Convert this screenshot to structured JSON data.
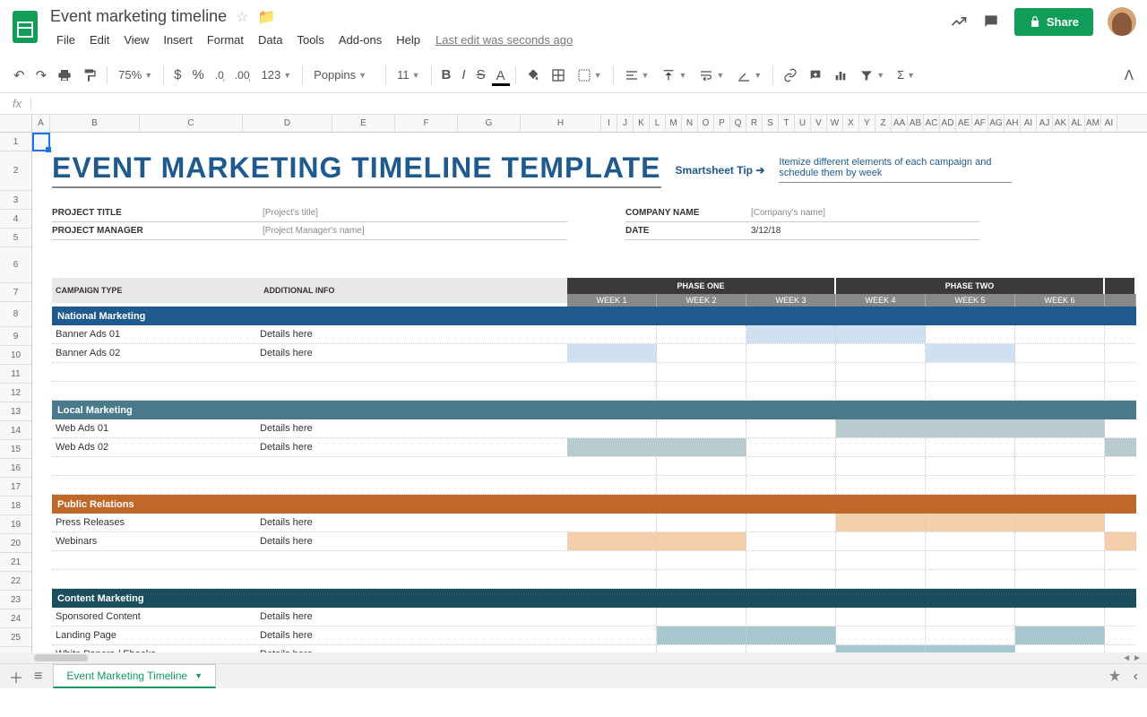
{
  "doc": {
    "title": "Event marketing timeline",
    "last_edit": "Last edit was seconds ago"
  },
  "menu": [
    "File",
    "Edit",
    "View",
    "Insert",
    "Format",
    "Data",
    "Tools",
    "Add-ons",
    "Help"
  ],
  "share": "Share",
  "toolbar": {
    "zoom": "75%",
    "numfmt": "123",
    "font": "Poppins",
    "size": "11"
  },
  "cols_wide": [
    "A",
    "B",
    "C",
    "D",
    "E",
    "F",
    "G",
    "H"
  ],
  "cols_narrow": [
    "I",
    "J",
    "K",
    "L",
    "M",
    "N",
    "O",
    "P",
    "Q",
    "R",
    "S",
    "T",
    "U",
    "V",
    "W",
    "X",
    "Y",
    "Z",
    "AA",
    "AB",
    "AC",
    "AD",
    "AE",
    "AF",
    "AG",
    "AH",
    "AI",
    "AJ",
    "AK",
    "AL",
    "AM",
    "AI"
  ],
  "sheet": {
    "title": "EVENT MARKETING TIMELINE TEMPLATE",
    "tip_label": "Smartsheet Tip ➔",
    "tip_text": "Itemize different elements of each campaign and schedule them by week",
    "meta": {
      "project_title_label": "PROJECT TITLE",
      "project_title_val": "[Project's title]",
      "pm_label": "PROJECT MANAGER",
      "pm_val": "[Project Manager's name]",
      "company_label": "COMPANY NAME",
      "company_val": "[Company's name]",
      "date_label": "DATE",
      "date_val": "3/12/18"
    },
    "headers": {
      "campaign": "CAMPAIGN TYPE",
      "info": "ADDITIONAL INFO",
      "phase1": "PHASE ONE",
      "phase2": "PHASE TWO",
      "weeks": [
        "WEEK 1",
        "WEEK 2",
        "WEEK 3",
        "WEEK 4",
        "WEEK 5",
        "WEEK 6"
      ]
    },
    "sections": {
      "national": {
        "name": "National Marketing",
        "rows": [
          {
            "name": "Banner Ads 01",
            "info": "Details here",
            "fill": [
              0,
              0,
              1,
              1,
              0,
              0,
              0
            ],
            "color": "c-blue"
          },
          {
            "name": "Banner Ads 02",
            "info": "Details here",
            "fill": [
              1,
              0,
              0,
              0,
              1,
              0,
              0
            ],
            "color": "c-blue"
          }
        ]
      },
      "local": {
        "name": "Local Marketing",
        "rows": [
          {
            "name": "Web Ads 01",
            "info": "Details here",
            "fill": [
              0,
              0,
              0,
              1,
              1,
              1,
              0
            ],
            "color": "c-teal"
          },
          {
            "name": "Web Ads 02",
            "info": "Details here",
            "fill": [
              1,
              1,
              0,
              0,
              0,
              0,
              1
            ],
            "color": "c-teal"
          }
        ]
      },
      "pr": {
        "name": "Public Relations",
        "rows": [
          {
            "name": "Press Releases",
            "info": "Details here",
            "fill": [
              0,
              0,
              0,
              1,
              1,
              1,
              0
            ],
            "color": "c-orange"
          },
          {
            "name": "Webinars",
            "info": "Details here",
            "fill": [
              1,
              1,
              0,
              0,
              0,
              0,
              1
            ],
            "color": "c-orange"
          }
        ]
      },
      "content": {
        "name": "Content Marketing",
        "rows": [
          {
            "name": "Sponsored Content",
            "info": "Details here",
            "fill": [
              0,
              0,
              0,
              0,
              0,
              0,
              0
            ],
            "color": "c-dteal"
          },
          {
            "name": "Landing Page",
            "info": "Details here",
            "fill": [
              0,
              1,
              1,
              0,
              0,
              1,
              0
            ],
            "color": "c-dteal"
          },
          {
            "name": "White Papers / Ebooks",
            "info": "Details here",
            "fill": [
              0,
              0,
              0,
              1,
              1,
              0,
              0
            ],
            "color": "c-dteal"
          }
        ]
      }
    }
  },
  "tab": "Event Marketing Timeline"
}
